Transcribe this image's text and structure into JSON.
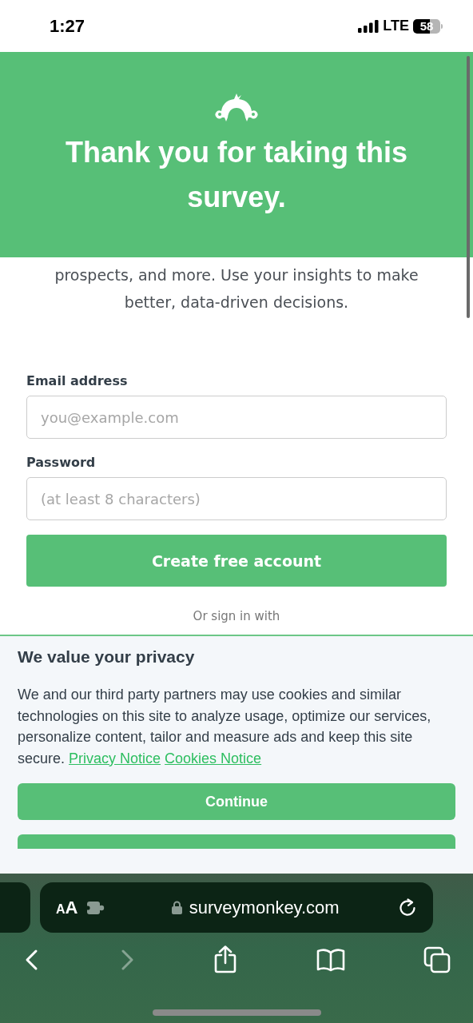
{
  "status_bar": {
    "time": "1:27",
    "network": "LTE",
    "battery": "58"
  },
  "header": {
    "title": "Thank you for taking this survey."
  },
  "intro": "prospects, and more. Use your insights to make better, data-driven decisions.",
  "form": {
    "fields": [
      {
        "label": "Email address",
        "placeholder": "you@example.com"
      },
      {
        "label": "Password",
        "placeholder": "(at least 8 characters)"
      }
    ],
    "submit": "Create free account",
    "alt_signin": "Or sign in with"
  },
  "privacy": {
    "title": "We value your privacy",
    "text": "We and our third party partners may use cookies and similar technologies on this site to analyze usage, optimize our services, personalize content, tailor and measure ads and keep this site secure.",
    "links": [
      "Privacy Notice",
      "Cookies Notice"
    ],
    "buttons": [
      {
        "kind": "full",
        "label": "Continue"
      },
      {
        "kind": "hidden"
      }
    ]
  },
  "browser": {
    "text_size": "AA",
    "url": "surveymonkey.com",
    "toolbar": [
      {
        "kind": "back",
        "disabled": false
      },
      {
        "kind": "forward",
        "disabled": true
      },
      {
        "kind": "share",
        "disabled": false
      },
      {
        "kind": "bookmarks",
        "disabled": false
      },
      {
        "kind": "tabs",
        "disabled": false
      }
    ]
  }
}
